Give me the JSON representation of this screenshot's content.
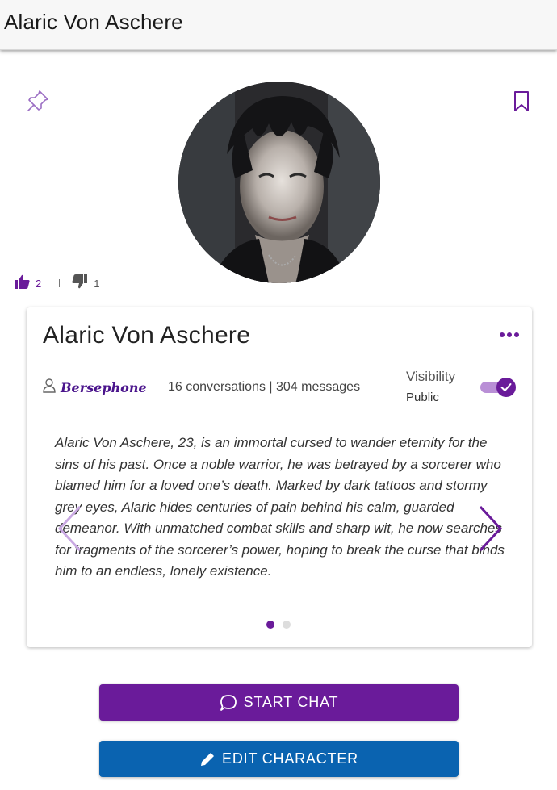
{
  "header": {
    "title": "Alaric Von Aschere"
  },
  "icons": {
    "pin": "pin-icon",
    "bookmark": "bookmark-icon",
    "thumbs_up": "thumbs-up-icon",
    "thumbs_down": "thumbs-down-icon",
    "more": "more-horizontal-icon",
    "user": "user-icon",
    "chat": "chat-bubble-icon",
    "edit": "pencil-icon",
    "prev": "chevron-left-icon",
    "next": "chevron-right-icon"
  },
  "rating": {
    "likes": "2",
    "dislikes": "1"
  },
  "card": {
    "name": "Alaric Von Aschere",
    "author": "Bersephone",
    "stats": "16 conversations | 304 messages",
    "visibility_label": "Visibility",
    "visibility_value": "Public",
    "visibility_on": true,
    "description": "Alaric Von Aschere, 23, is an immortal cursed to wander eternity for the sins of his past. Once a noble warrior, he was betrayed by a sorcerer who blamed him for a loved one’s death. Marked by dark tattoos and stormy grey eyes, Alaric hides centuries of pain behind his calm, guarded demeanor. With unmatched combat skills and sharp wit, he now searches for fragments of the sorcerer’s power, hoping to break the curse that binds him to an endless, lonely existence.",
    "pages": 2,
    "active_page": 1
  },
  "buttons": {
    "start_chat": "START CHAT",
    "edit_character": "EDIT CHARACTER"
  },
  "colors": {
    "primary": "#6a1b9a",
    "secondary_button": "#0a63b0",
    "toggle_track": "#b98fd6"
  }
}
